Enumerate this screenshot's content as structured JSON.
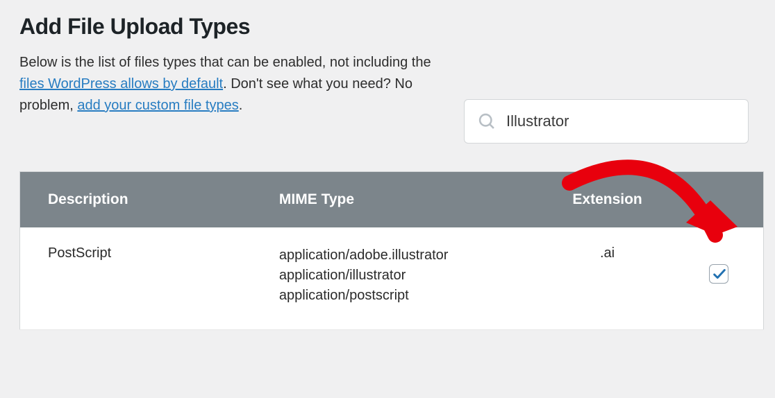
{
  "page": {
    "title": "Add File Upload Types"
  },
  "intro": {
    "part1": "Below is the list of files types that can be enabled, not including the ",
    "link1": "files WordPress allows by default",
    "part2": ". Don't see what you need? No problem, ",
    "link2": "add your custom file types",
    "part3": "."
  },
  "search": {
    "value": "Illustrator"
  },
  "table": {
    "headers": {
      "description": "Description",
      "mime": "MIME Type",
      "extension": "Extension"
    },
    "rows": [
      {
        "description": "PostScript",
        "mime": [
          "application/adobe.illustrator",
          "application/illustrator",
          "application/postscript"
        ],
        "extension": ".ai",
        "checked": true
      }
    ]
  }
}
